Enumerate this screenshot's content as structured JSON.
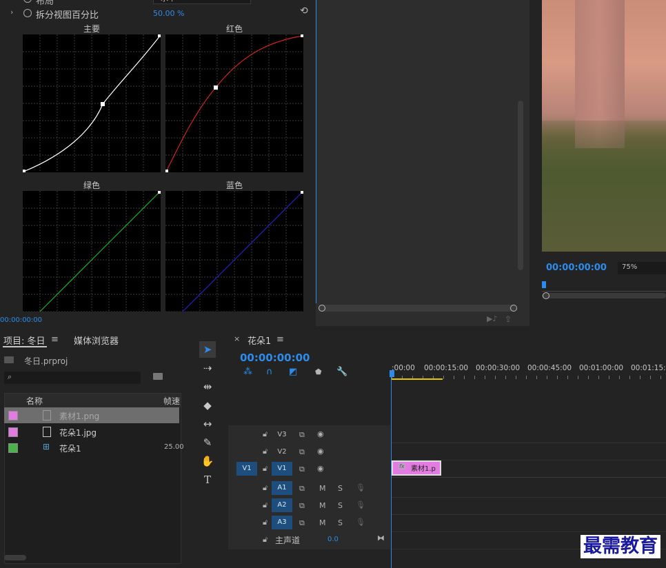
{
  "effects": {
    "row_top_label": "布局",
    "row_top_value": "水平",
    "split_label": "拆分视图百分比",
    "split_value": "50.00 %",
    "curves": [
      {
        "label": "主要"
      },
      {
        "label": "红色"
      },
      {
        "label": "绿色"
      },
      {
        "label": "蓝色"
      }
    ],
    "timecode": "00:00:00:00"
  },
  "program_monitor": {
    "timecode": "00:00:00:00",
    "zoom": "75%"
  },
  "project": {
    "tab_label": "项目: 冬日",
    "media_browser_label": "媒体浏览器",
    "project_file": "冬日.prproj",
    "column_name": "名称",
    "column_fps": "帧速",
    "items": [
      {
        "name": "素材1.png",
        "fps": "",
        "color": "#e37ce0",
        "icon": "image-icon"
      },
      {
        "name": "花朵1.jpg",
        "fps": "",
        "color": "#e37ce0",
        "icon": "image-icon"
      },
      {
        "name": "花朵1",
        "fps": "25.00",
        "color": "#4ab34a",
        "icon": "sequence-icon"
      }
    ]
  },
  "timeline": {
    "tab_label": "花朵1",
    "timecode": "00:00:00:00",
    "ruler": [
      ":00:00",
      "00:00:15:00",
      "00:00:30:00",
      "00:00:45:00",
      "00:01:00:00",
      "00:01:15:00"
    ],
    "tracks": {
      "v3": "V3",
      "v2": "V2",
      "v1": "V1",
      "v1_source": "V1",
      "a1": "A1",
      "a2": "A2",
      "a3": "A3",
      "mute": "M",
      "solo": "S",
      "master_label": "主声道",
      "master_value": "0.0"
    },
    "clip_label": "素材1.p",
    "clip_fx": "fx"
  },
  "watermark": "最需教育",
  "colors": {
    "accent": "#2d8ceb",
    "clip": "#e37ce0",
    "target": "#1d4e7d"
  }
}
